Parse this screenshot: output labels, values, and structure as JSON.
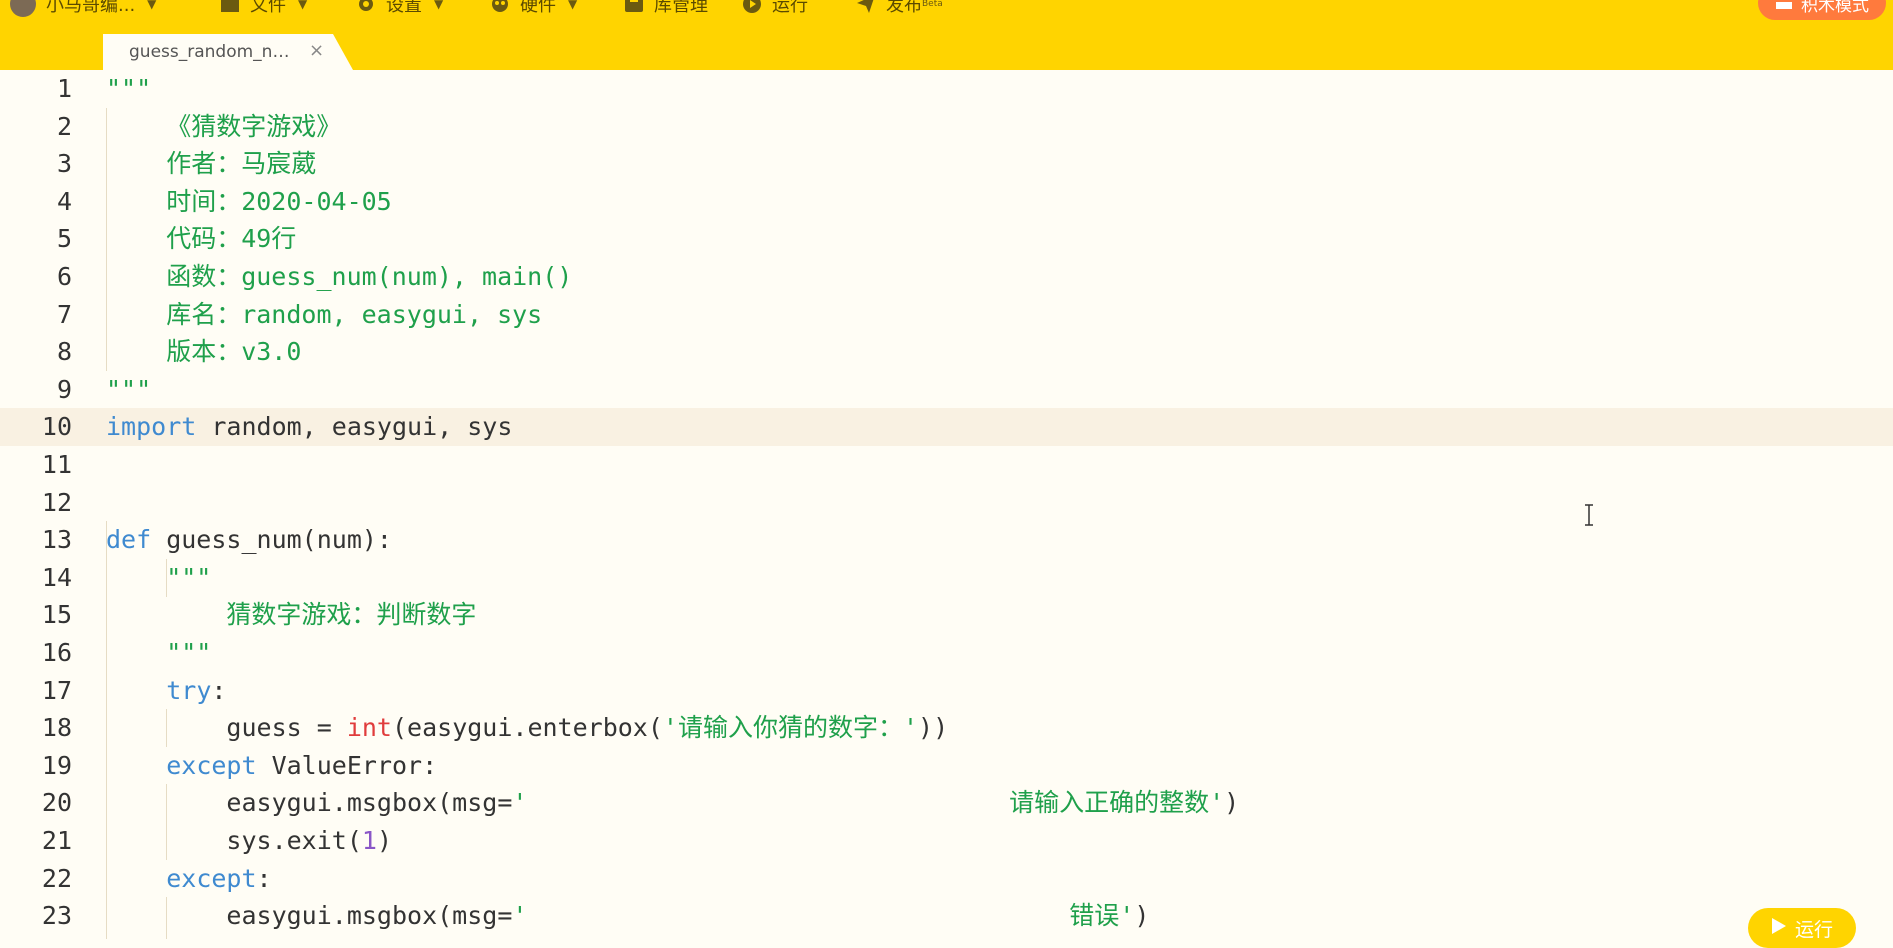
{
  "toolbar": {
    "brand": "小马哥编...",
    "file": "文件",
    "settings": "设置",
    "hardware": "硬件",
    "library": "库管理",
    "run": "运行",
    "publish": "发布",
    "publish_badge": "Beta",
    "block_mode": "积木模式"
  },
  "tab": {
    "title": "guess_random_nu...",
    "close": "×"
  },
  "editor": {
    "lines": [
      {
        "n": "1",
        "segs": [
          {
            "t": "\"\"\"",
            "c": "s"
          }
        ]
      },
      {
        "n": "2",
        "segs": [
          {
            "t": "    《猜数字游戏》",
            "c": "s"
          }
        ]
      },
      {
        "n": "3",
        "segs": [
          {
            "t": "    作者：马宸葳",
            "c": "s"
          }
        ]
      },
      {
        "n": "4",
        "segs": [
          {
            "t": "    时间：2020-04-05",
            "c": "s"
          }
        ]
      },
      {
        "n": "5",
        "segs": [
          {
            "t": "    代码：49行",
            "c": "s"
          }
        ]
      },
      {
        "n": "6",
        "segs": [
          {
            "t": "    函数：guess_num(num), main()",
            "c": "s"
          }
        ]
      },
      {
        "n": "7",
        "segs": [
          {
            "t": "    库名：random, easygui, sys",
            "c": "s"
          }
        ]
      },
      {
        "n": "8",
        "segs": [
          {
            "t": "    版本：v3.0",
            "c": "s"
          }
        ]
      },
      {
        "n": "9",
        "segs": [
          {
            "t": "\"\"\"",
            "c": "s"
          }
        ]
      },
      {
        "n": "10",
        "active": true,
        "segs": [
          {
            "t": "import",
            "c": "k"
          },
          {
            "t": " random, easygui, sys",
            "c": "p"
          }
        ]
      },
      {
        "n": "11",
        "segs": []
      },
      {
        "n": "12",
        "segs": []
      },
      {
        "n": "13",
        "segs": [
          {
            "t": "def",
            "c": "k"
          },
          {
            "t": " guess_num(num):",
            "c": "p"
          }
        ]
      },
      {
        "n": "14",
        "segs": [
          {
            "t": "    \"\"\"",
            "c": "s"
          }
        ]
      },
      {
        "n": "15",
        "segs": [
          {
            "t": "        猜数字游戏：判断数字",
            "c": "s"
          }
        ]
      },
      {
        "n": "16",
        "segs": [
          {
            "t": "    \"\"\"",
            "c": "s"
          }
        ]
      },
      {
        "n": "17",
        "segs": [
          {
            "t": "    ",
            "c": "p"
          },
          {
            "t": "try",
            "c": "k"
          },
          {
            "t": ":",
            "c": "p"
          }
        ]
      },
      {
        "n": "18",
        "segs": [
          {
            "t": "        guess = ",
            "c": "p"
          },
          {
            "t": "int",
            "c": "b"
          },
          {
            "t": "(easygui.enterbox(",
            "c": "p"
          },
          {
            "t": "'请输入你猜的数字：'",
            "c": "s"
          },
          {
            "t": "))",
            "c": "p"
          }
        ]
      },
      {
        "n": "19",
        "segs": [
          {
            "t": "    ",
            "c": "p"
          },
          {
            "t": "except",
            "c": "k"
          },
          {
            "t": " ValueError:",
            "c": "p"
          }
        ]
      },
      {
        "n": "20",
        "segs": [
          {
            "t": "        easygui.msgbox(msg=",
            "c": "p"
          },
          {
            "t": "'                                请输入正确的整数'",
            "c": "s"
          },
          {
            "t": ")",
            "c": "p"
          }
        ]
      },
      {
        "n": "21",
        "segs": [
          {
            "t": "        sys.exit(",
            "c": "p"
          },
          {
            "t": "1",
            "c": "n"
          },
          {
            "t": ")",
            "c": "p"
          }
        ]
      },
      {
        "n": "22",
        "segs": [
          {
            "t": "    ",
            "c": "p"
          },
          {
            "t": "except",
            "c": "k"
          },
          {
            "t": ":",
            "c": "p"
          }
        ]
      },
      {
        "n": "23",
        "segs": [
          {
            "t": "        easygui.msgbox(msg=",
            "c": "p"
          },
          {
            "t": "'                                    错误'",
            "c": "s"
          },
          {
            "t": ")",
            "c": "p"
          }
        ]
      }
    ]
  },
  "run_button": {
    "label": "运行"
  },
  "colors": {
    "accent": "#ffd400",
    "block_mode": "#ff7a3d",
    "string": "#1fa04b",
    "keyword": "#3f8ad0"
  }
}
